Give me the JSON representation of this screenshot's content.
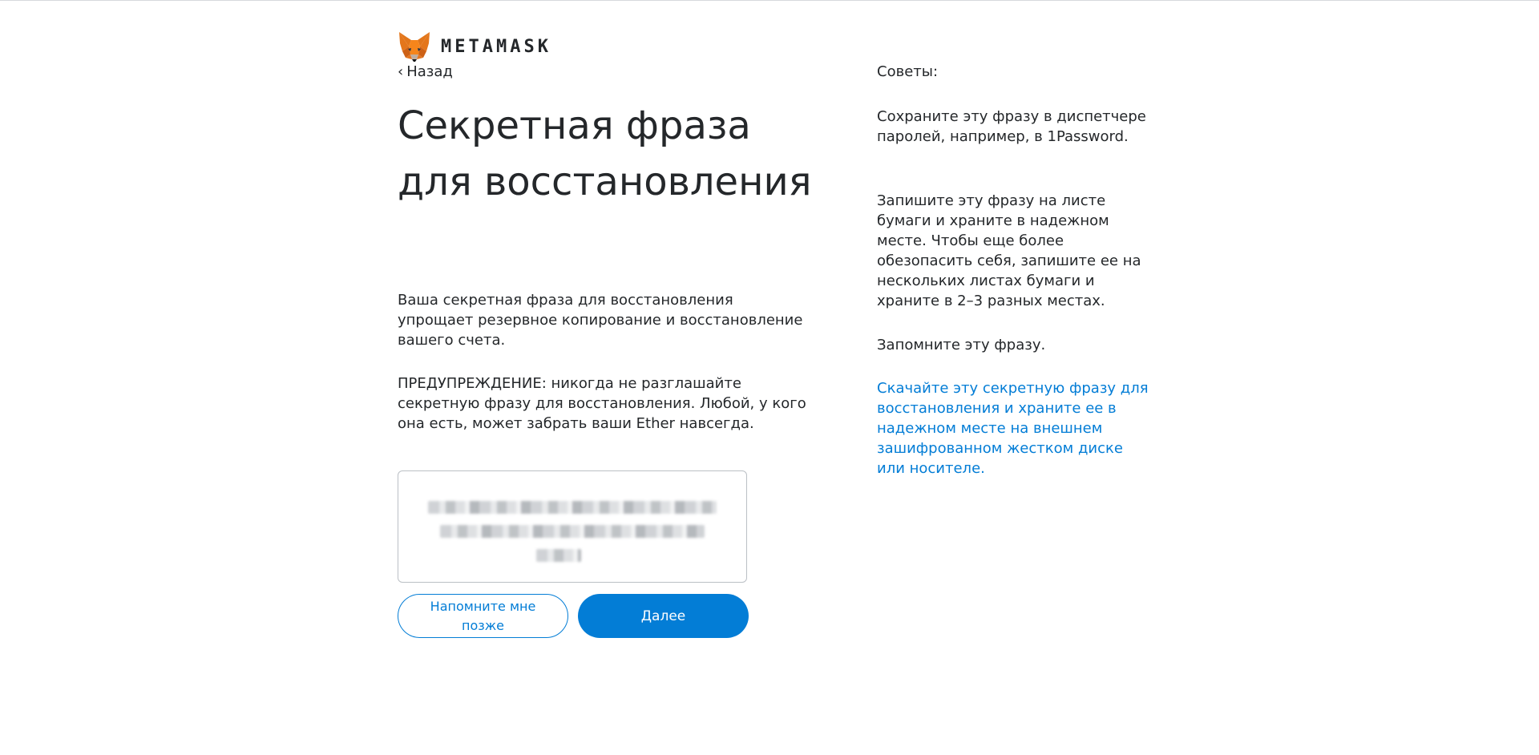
{
  "brand": {
    "wordmark": "METAMASK",
    "accent_color": "#037dd6",
    "logo_icon": "metamask-fox-icon"
  },
  "nav": {
    "back_label": "Назад",
    "back_icon": "chevron-left-icon"
  },
  "main": {
    "title": "Секретная фраза для восстановления",
    "description": "Ваша секретная фраза для восстановления упрощает резервное копирование и восстановление вашего счета.",
    "warning": "ПРЕДУПРЕЖДЕНИЕ: никогда не разглашайте секретную фразу для восстановления. Любой, у кого она есть, может забрать ваши Ether навсегда.",
    "secret_phrase_state": "blurred",
    "remind_later_label": "Напомните мне позже",
    "next_label": "Далее"
  },
  "tips": {
    "heading": "Советы:",
    "items": [
      "Сохраните эту фразу в диспетчере паролей, например, в 1Password.",
      "Запишите эту фразу на листе бумаги и храните в надежном месте. Чтобы еще более обезопасить себя, запишите ее на нескольких листах бумаги и храните в 2–3 разных местах.",
      "Запомните эту фразу."
    ],
    "download_link": "Скачайте эту секретную фразу для восстановления и храните ее в надежном месте на внешнем зашифрованном жестком диске или носителе."
  }
}
